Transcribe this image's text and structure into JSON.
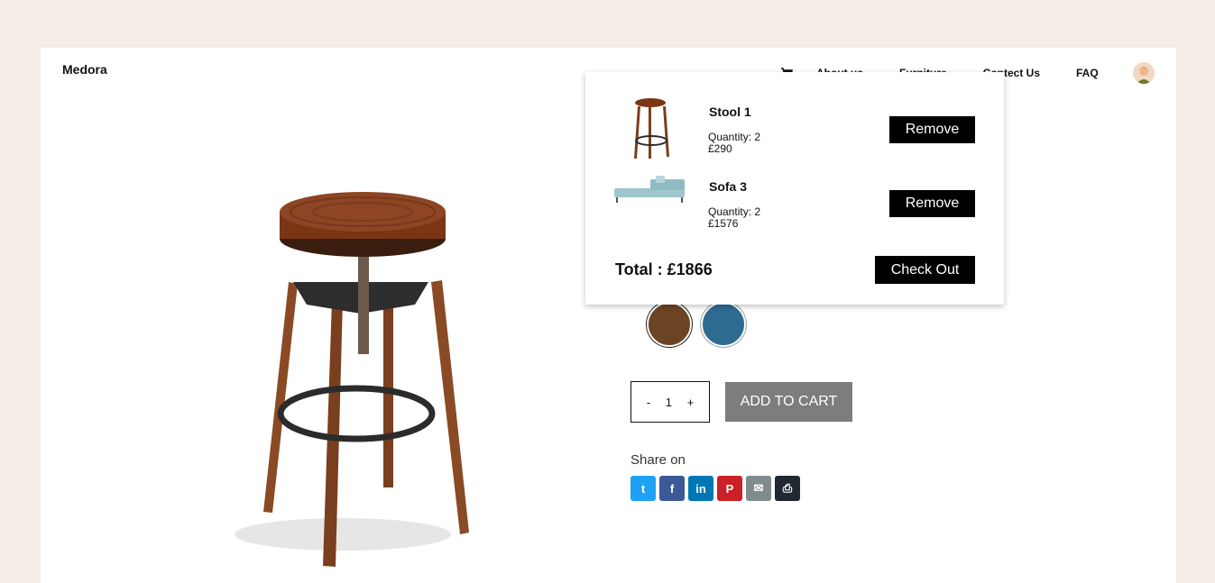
{
  "brand": "Medora",
  "nav": {
    "items": [
      "About us",
      "Furniture",
      "Contect Us",
      "FAQ"
    ]
  },
  "cart": {
    "items": [
      {
        "name": "Stool 1",
        "quantity": "Quantity: 2",
        "price": "£290",
        "remove_label": "Remove"
      },
      {
        "name": "Sofa 3",
        "quantity": "Quantity: 2",
        "price": "£1576",
        "remove_label": "Remove"
      }
    ],
    "total": "Total : £1866",
    "checkout_label": "Check Out"
  },
  "product": {
    "swatches": [
      "#6b4423",
      "#2e6b91"
    ],
    "quantity": "1",
    "minus": "-",
    "plus": "+",
    "add_to_cart": "ADD TO CART"
  },
  "share": {
    "label": "Share on",
    "icons": [
      {
        "name": "twitter-icon",
        "glyph": "t",
        "color": "#1da1f2"
      },
      {
        "name": "facebook-icon",
        "glyph": "f",
        "color": "#3b5998"
      },
      {
        "name": "linkedin-icon",
        "glyph": "in",
        "color": "#0077b5"
      },
      {
        "name": "pinterest-icon",
        "glyph": "P",
        "color": "#cb2027"
      },
      {
        "name": "email-icon",
        "glyph": "✉",
        "color": "#7f8c8d"
      },
      {
        "name": "print-icon",
        "glyph": "⎙",
        "color": "#222831"
      }
    ]
  }
}
